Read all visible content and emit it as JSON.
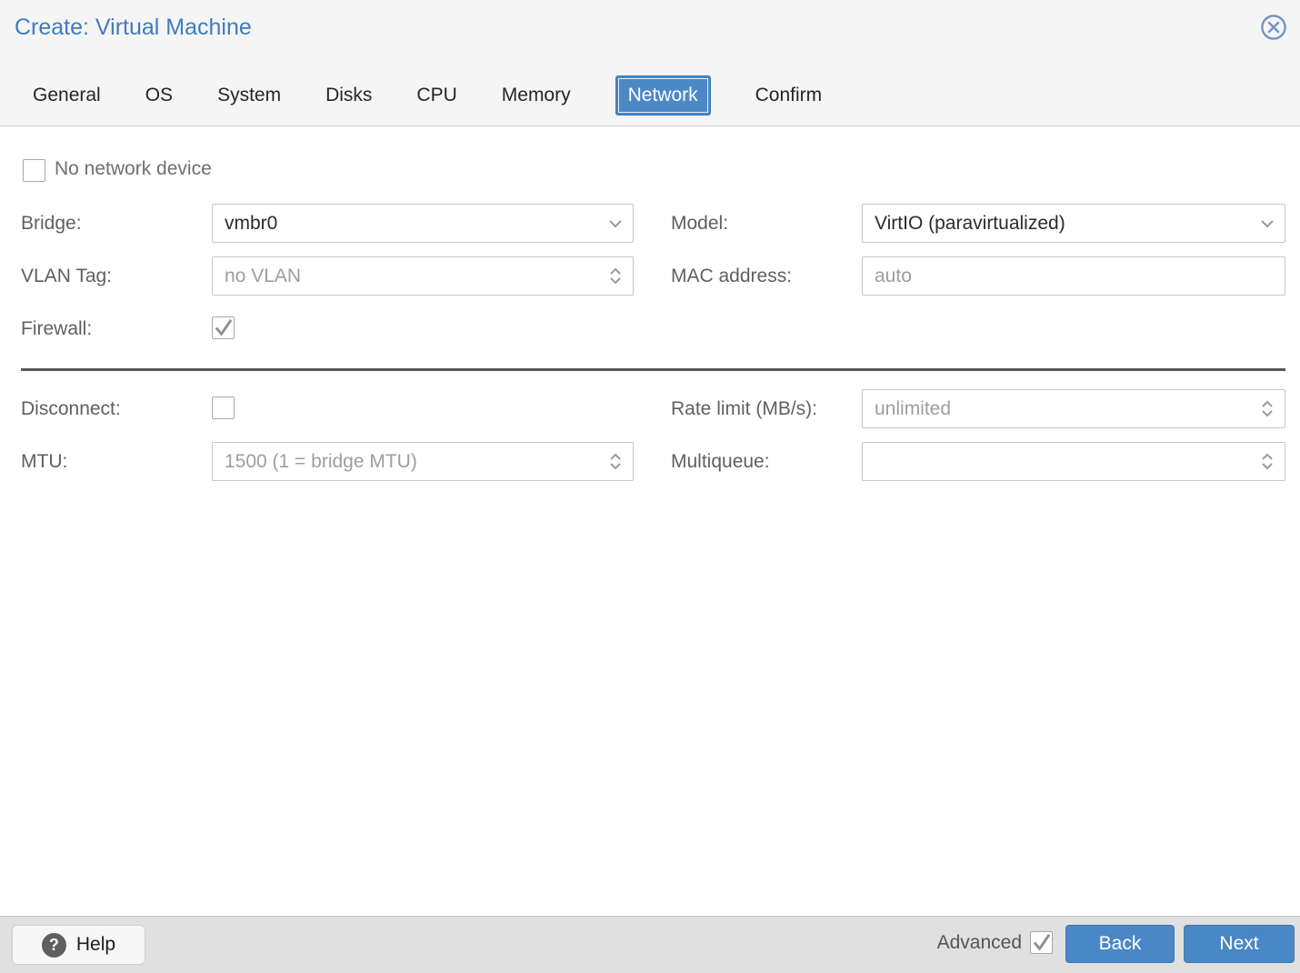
{
  "header": {
    "title": "Create: Virtual Machine",
    "close_icon": "circled-x"
  },
  "tabs": [
    {
      "label": "General",
      "active": false
    },
    {
      "label": "OS",
      "active": false
    },
    {
      "label": "System",
      "active": false
    },
    {
      "label": "Disks",
      "active": false
    },
    {
      "label": "CPU",
      "active": false
    },
    {
      "label": "Memory",
      "active": false
    },
    {
      "label": "Network",
      "active": true
    },
    {
      "label": "Confirm",
      "active": false
    }
  ],
  "form": {
    "no_network_device": {
      "label": "No network device",
      "checked": false
    },
    "bridge": {
      "label": "Bridge:",
      "value": "vmbr0",
      "type": "dropdown"
    },
    "model": {
      "label": "Model:",
      "value": "VirtIO (paravirtualized)",
      "type": "dropdown"
    },
    "vlan_tag": {
      "label": "VLAN Tag:",
      "placeholder": "no VLAN",
      "type": "spinner"
    },
    "mac": {
      "label": "MAC address:",
      "placeholder": "auto",
      "type": "text"
    },
    "firewall": {
      "label": "Firewall:",
      "checked": true
    },
    "disconnect": {
      "label": "Disconnect:",
      "checked": false
    },
    "rate_limit": {
      "label": "Rate limit (MB/s):",
      "placeholder": "unlimited",
      "type": "spinner"
    },
    "mtu": {
      "label": "MTU:",
      "placeholder": "1500 (1 = bridge MTU)",
      "type": "spinner"
    },
    "multiqueue": {
      "label": "Multiqueue:",
      "placeholder": "",
      "type": "spinner"
    }
  },
  "footer": {
    "help_label": "Help",
    "help_icon": "question-mark",
    "advanced": {
      "label": "Advanced",
      "checked": true
    },
    "back_label": "Back",
    "next_label": "Next"
  },
  "colors": {
    "accent_blue": "#4a87c6",
    "title_blue": "#3e7cc1",
    "header_bg": "#f5f5f5",
    "footer_bg": "#e0e0e0",
    "divider": "#585858",
    "label_gray": "#606060",
    "placeholder_gray": "#9e9e9e",
    "close_icon_blue": "#7495c3"
  }
}
